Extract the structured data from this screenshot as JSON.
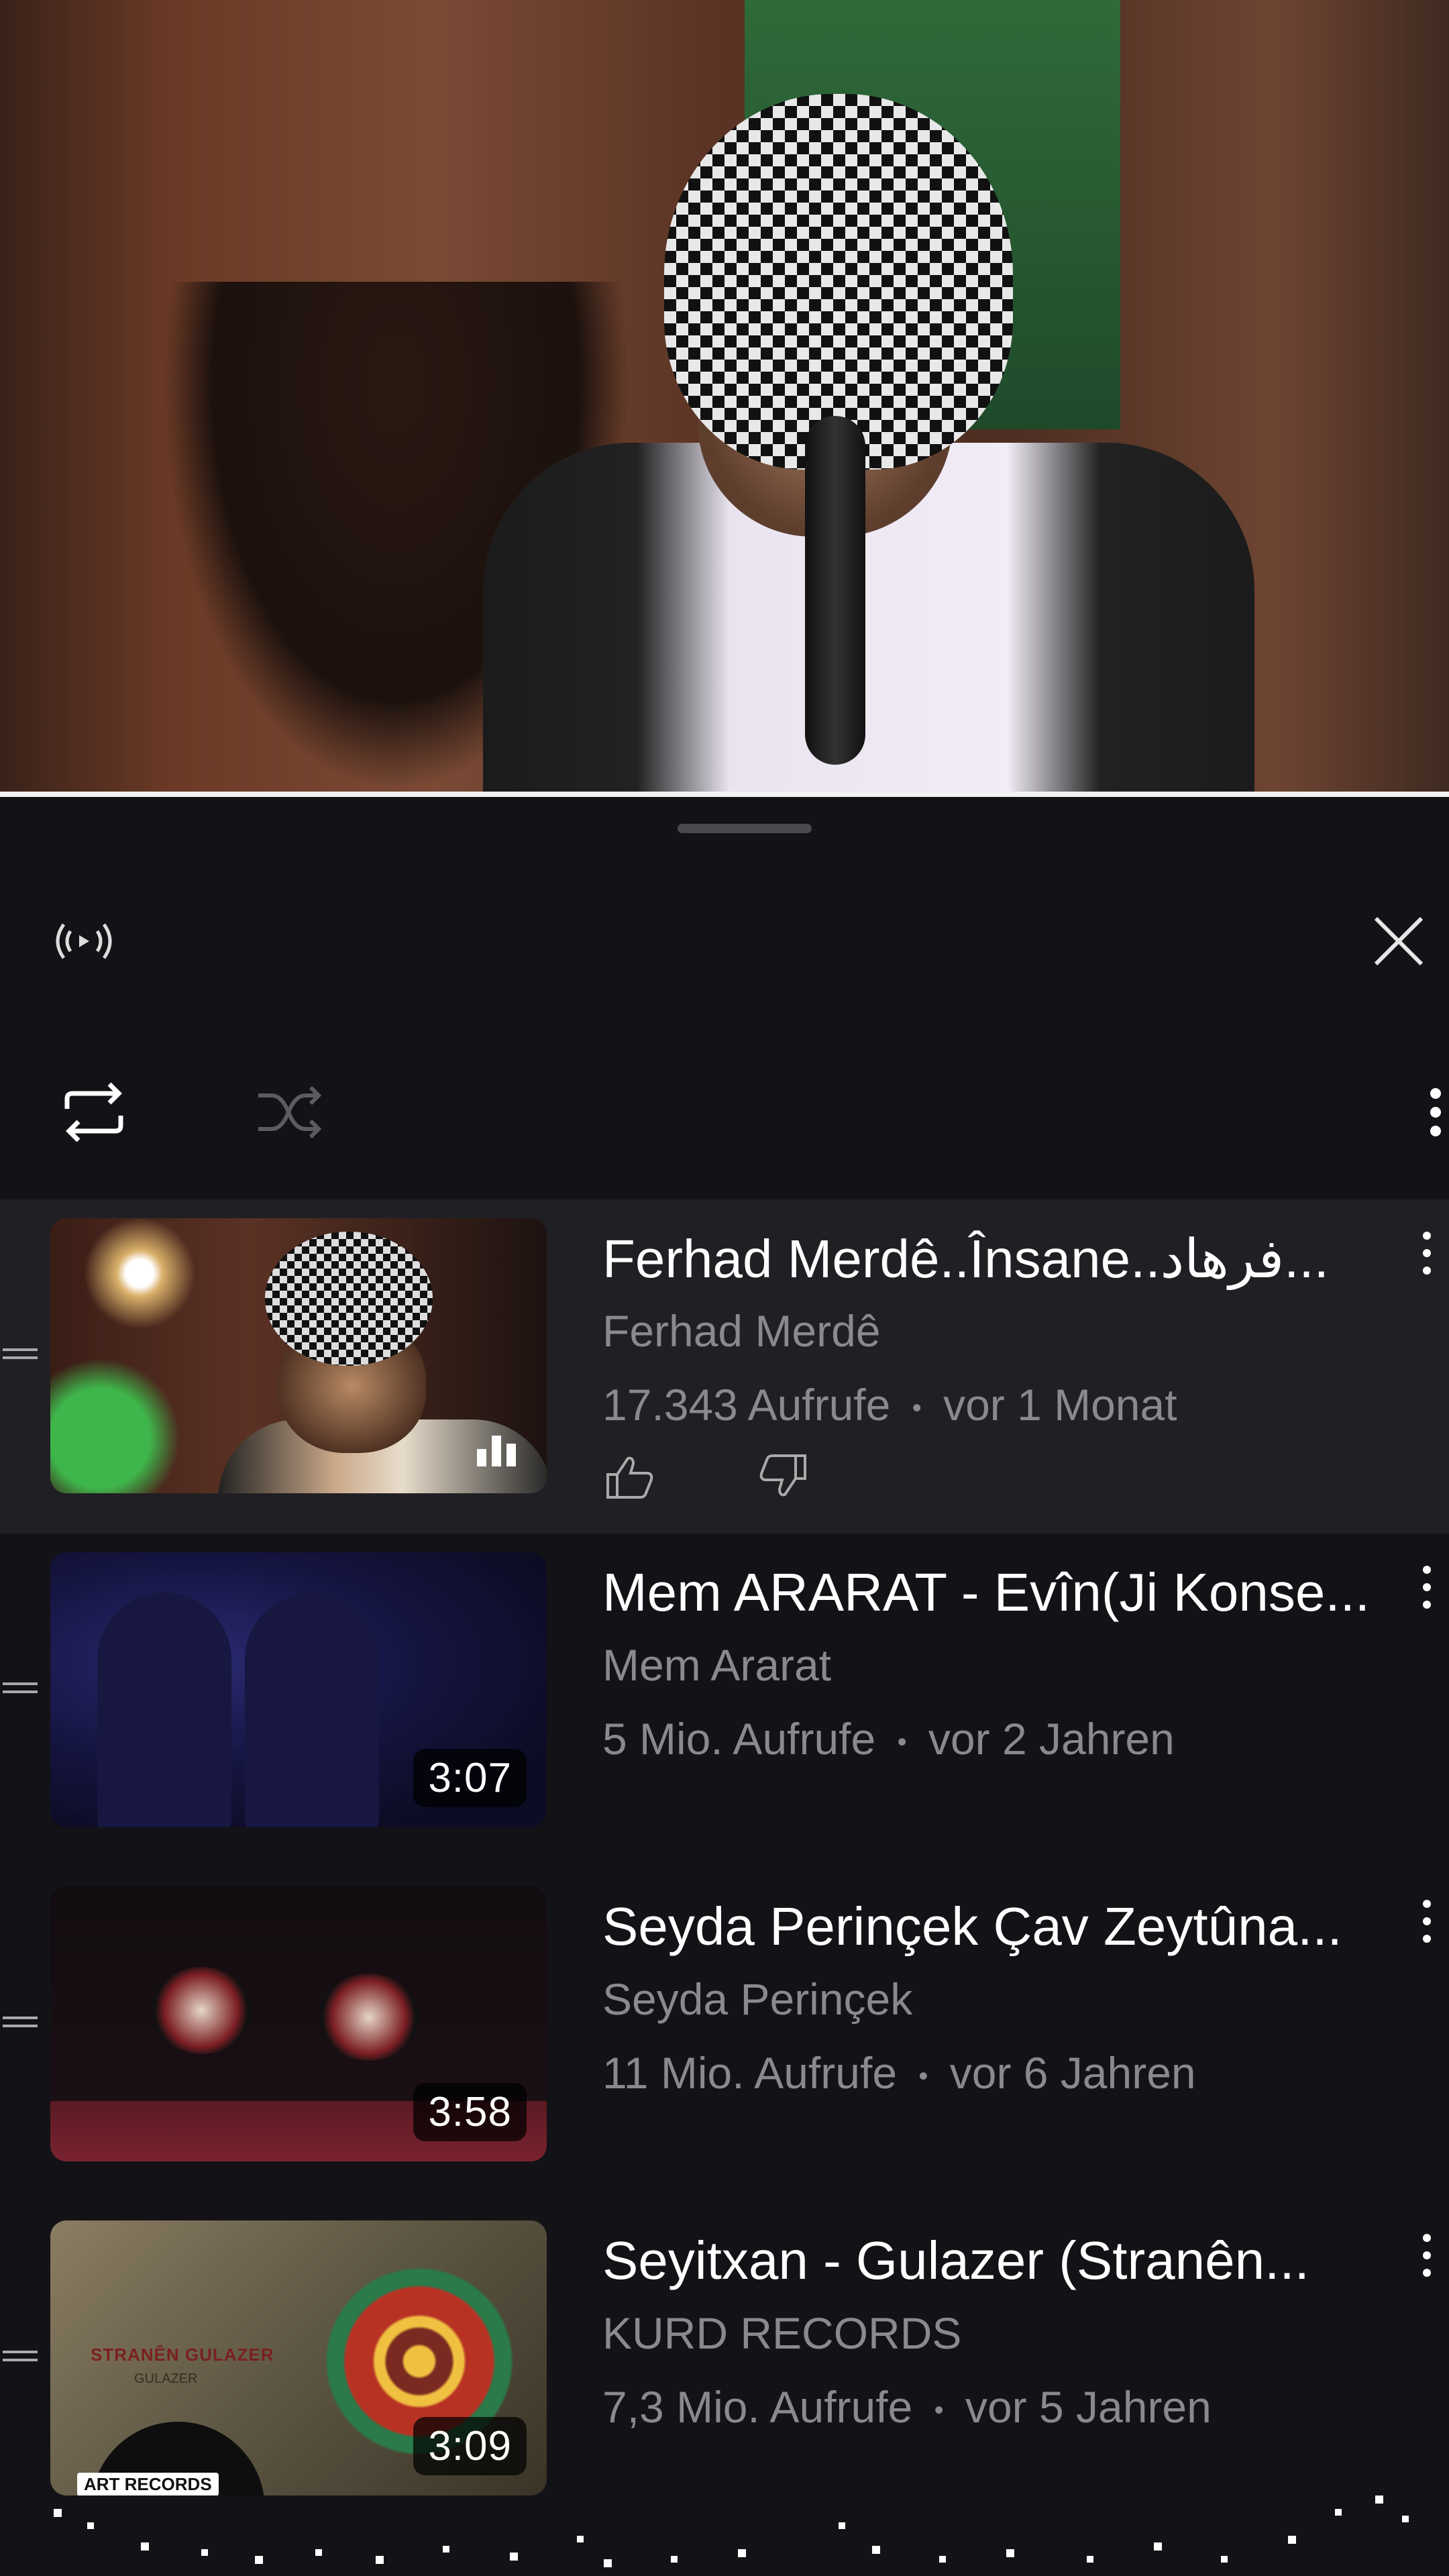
{
  "panel": {
    "live_icon": "cast-live-icon",
    "close_icon": "close-icon",
    "repeat_icon": "repeat-icon",
    "shuffle_icon": "shuffle-icon",
    "more_icon": "more-vertical-icon"
  },
  "playlist": [
    {
      "title": "Ferhad Merdê..Însane..فرهاد...",
      "channel": "Ferhad Merdê",
      "views": "17.343 Aufrufe",
      "age": "vor 1 Monat",
      "now_playing": true
    },
    {
      "title": "Mem ARARAT - Evîn(Ji Konse...",
      "channel": "Mem Ararat",
      "views": "5 Mio. Aufrufe",
      "age": "vor 2 Jahren",
      "duration": "3:07"
    },
    {
      "title": "Seyda Perinçek Çav Zeytûna...",
      "channel": "Seyda Perinçek",
      "views": "11 Mio. Aufrufe",
      "age": "vor 6 Jahren",
      "duration": "3:58"
    },
    {
      "title": "Seyitxan - Gulazer (Stranên...",
      "channel": "KURD RECORDS",
      "views": "7,3 Mio. Aufrufe",
      "age": "vor 5 Jahren",
      "duration": "3:09",
      "thumb_text": "STRANÊN GULAZER",
      "thumb_sub": "GULAZER",
      "thumb_logo": "ART RECORDS"
    }
  ],
  "separator": "•"
}
